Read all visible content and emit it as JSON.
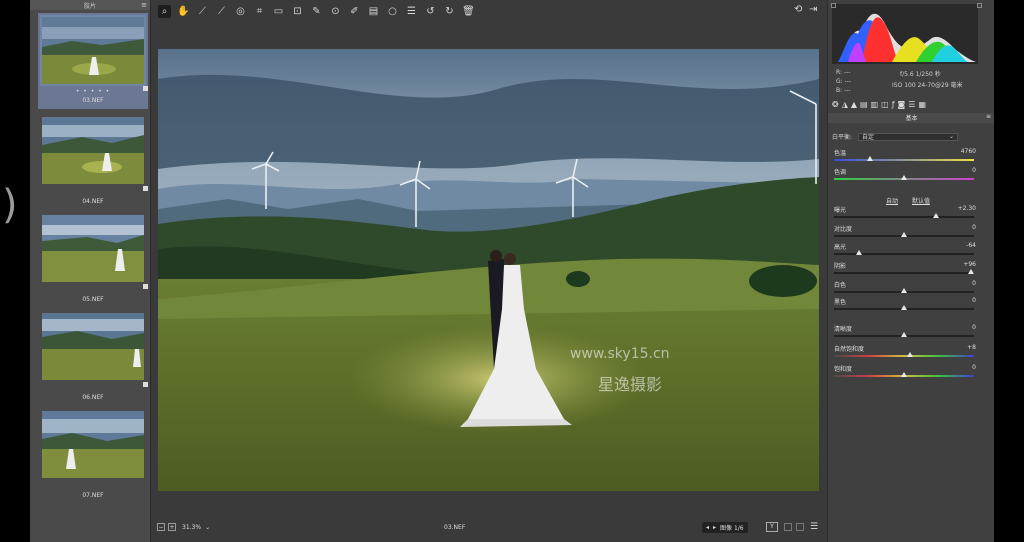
{
  "filmstrip": {
    "title": "胶片",
    "items": [
      {
        "name": "03.NEF",
        "stars": "• • • • •",
        "selected": true
      },
      {
        "name": "04.NEF",
        "selected": false
      },
      {
        "name": "05.NEF",
        "selected": false
      },
      {
        "name": "06.NEF",
        "selected": false
      },
      {
        "name": "07.NEF",
        "selected": false
      }
    ]
  },
  "toolbar": {
    "tools": [
      "zoom-icon",
      "hand-icon",
      "white-balance-icon",
      "color-sampler-icon",
      "target-adjust-icon",
      "crop-icon",
      "straighten-icon",
      "transform-icon",
      "spot-removal-icon",
      "red-eye-icon",
      "adjustment-brush-icon",
      "graduated-filter-icon",
      "radial-filter-icon",
      "presets-icon",
      "rotate-left-icon",
      "rotate-right-icon",
      "trash-icon"
    ]
  },
  "preview": {
    "watermark_url": "www.sky15.cn",
    "watermark_text": "星逸摄影"
  },
  "bottombar": {
    "zoom": "31.3%",
    "filename": "03.NEF",
    "image_counter": "图像 1/6",
    "y_toggle": "Y"
  },
  "info": {
    "r": "R:   ---",
    "g": "G:   ---",
    "b": "B:   ---",
    "aperture_shutter": "f/5.6   1/250 秒",
    "iso_lens": "ISO 100   24-70@29 毫米"
  },
  "panel": {
    "section": "基本",
    "wb_label": "白平衡:",
    "wb_value": "自定",
    "auto": "自动",
    "default": "默认值",
    "sliders": [
      {
        "label": "色温",
        "value": "4760",
        "fraction": 0.26
      },
      {
        "label": "色调",
        "value": "0",
        "fraction": 0.5
      },
      {
        "label": "曝光",
        "value": "+2.30",
        "fraction": 0.73
      },
      {
        "label": "对比度",
        "value": "0",
        "fraction": 0.5
      },
      {
        "label": "高光",
        "value": "-64",
        "fraction": 0.18
      },
      {
        "label": "阴影",
        "value": "+96",
        "fraction": 0.98
      },
      {
        "label": "白色",
        "value": "0",
        "fraction": 0.5
      },
      {
        "label": "黑色",
        "value": "0",
        "fraction": 0.5
      },
      {
        "label": "清晰度",
        "value": "0",
        "fraction": 0.5
      },
      {
        "label": "自然饱和度",
        "value": "+8",
        "fraction": 0.54
      },
      {
        "label": "饱和度",
        "value": "0",
        "fraction": 0.5
      }
    ]
  },
  "colors": {
    "accent": "#6f86a8",
    "panel_bg": "#404040",
    "app_bg": "#3a3a3a"
  }
}
